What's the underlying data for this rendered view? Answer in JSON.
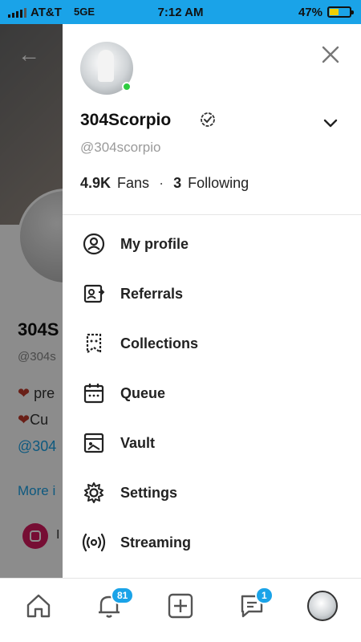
{
  "status_bar": {
    "carrier": "AT&T",
    "network": "5GE",
    "time": "7:12 AM",
    "battery": "47%",
    "battery_level": 0.47
  },
  "background_profile": {
    "name": "304S",
    "handle": "@304s",
    "line1": "pre",
    "line2": "Cu",
    "line3": "@304",
    "more": "More i",
    "instagram": "I"
  },
  "drawer": {
    "name": "304Scorpio",
    "handle": "@304scorpio",
    "fans_count": "4.9K",
    "fans_label": "Fans",
    "separator": "·",
    "following_count": "3",
    "following_label": "Following",
    "menu": [
      {
        "label": "My profile",
        "icon": "user-circle-icon"
      },
      {
        "label": "Referrals",
        "icon": "referral-icon"
      },
      {
        "label": "Collections",
        "icon": "bookmark-icon"
      },
      {
        "label": "Queue",
        "icon": "calendar-icon"
      },
      {
        "label": "Vault",
        "icon": "image-vault-icon"
      },
      {
        "label": "Settings",
        "icon": "gear-icon"
      },
      {
        "label": "Streaming",
        "icon": "streaming-icon"
      }
    ]
  },
  "bottom_nav": {
    "notifications_badge": "81",
    "messages_badge": "1",
    "accent_color": "#1aa3e8"
  }
}
